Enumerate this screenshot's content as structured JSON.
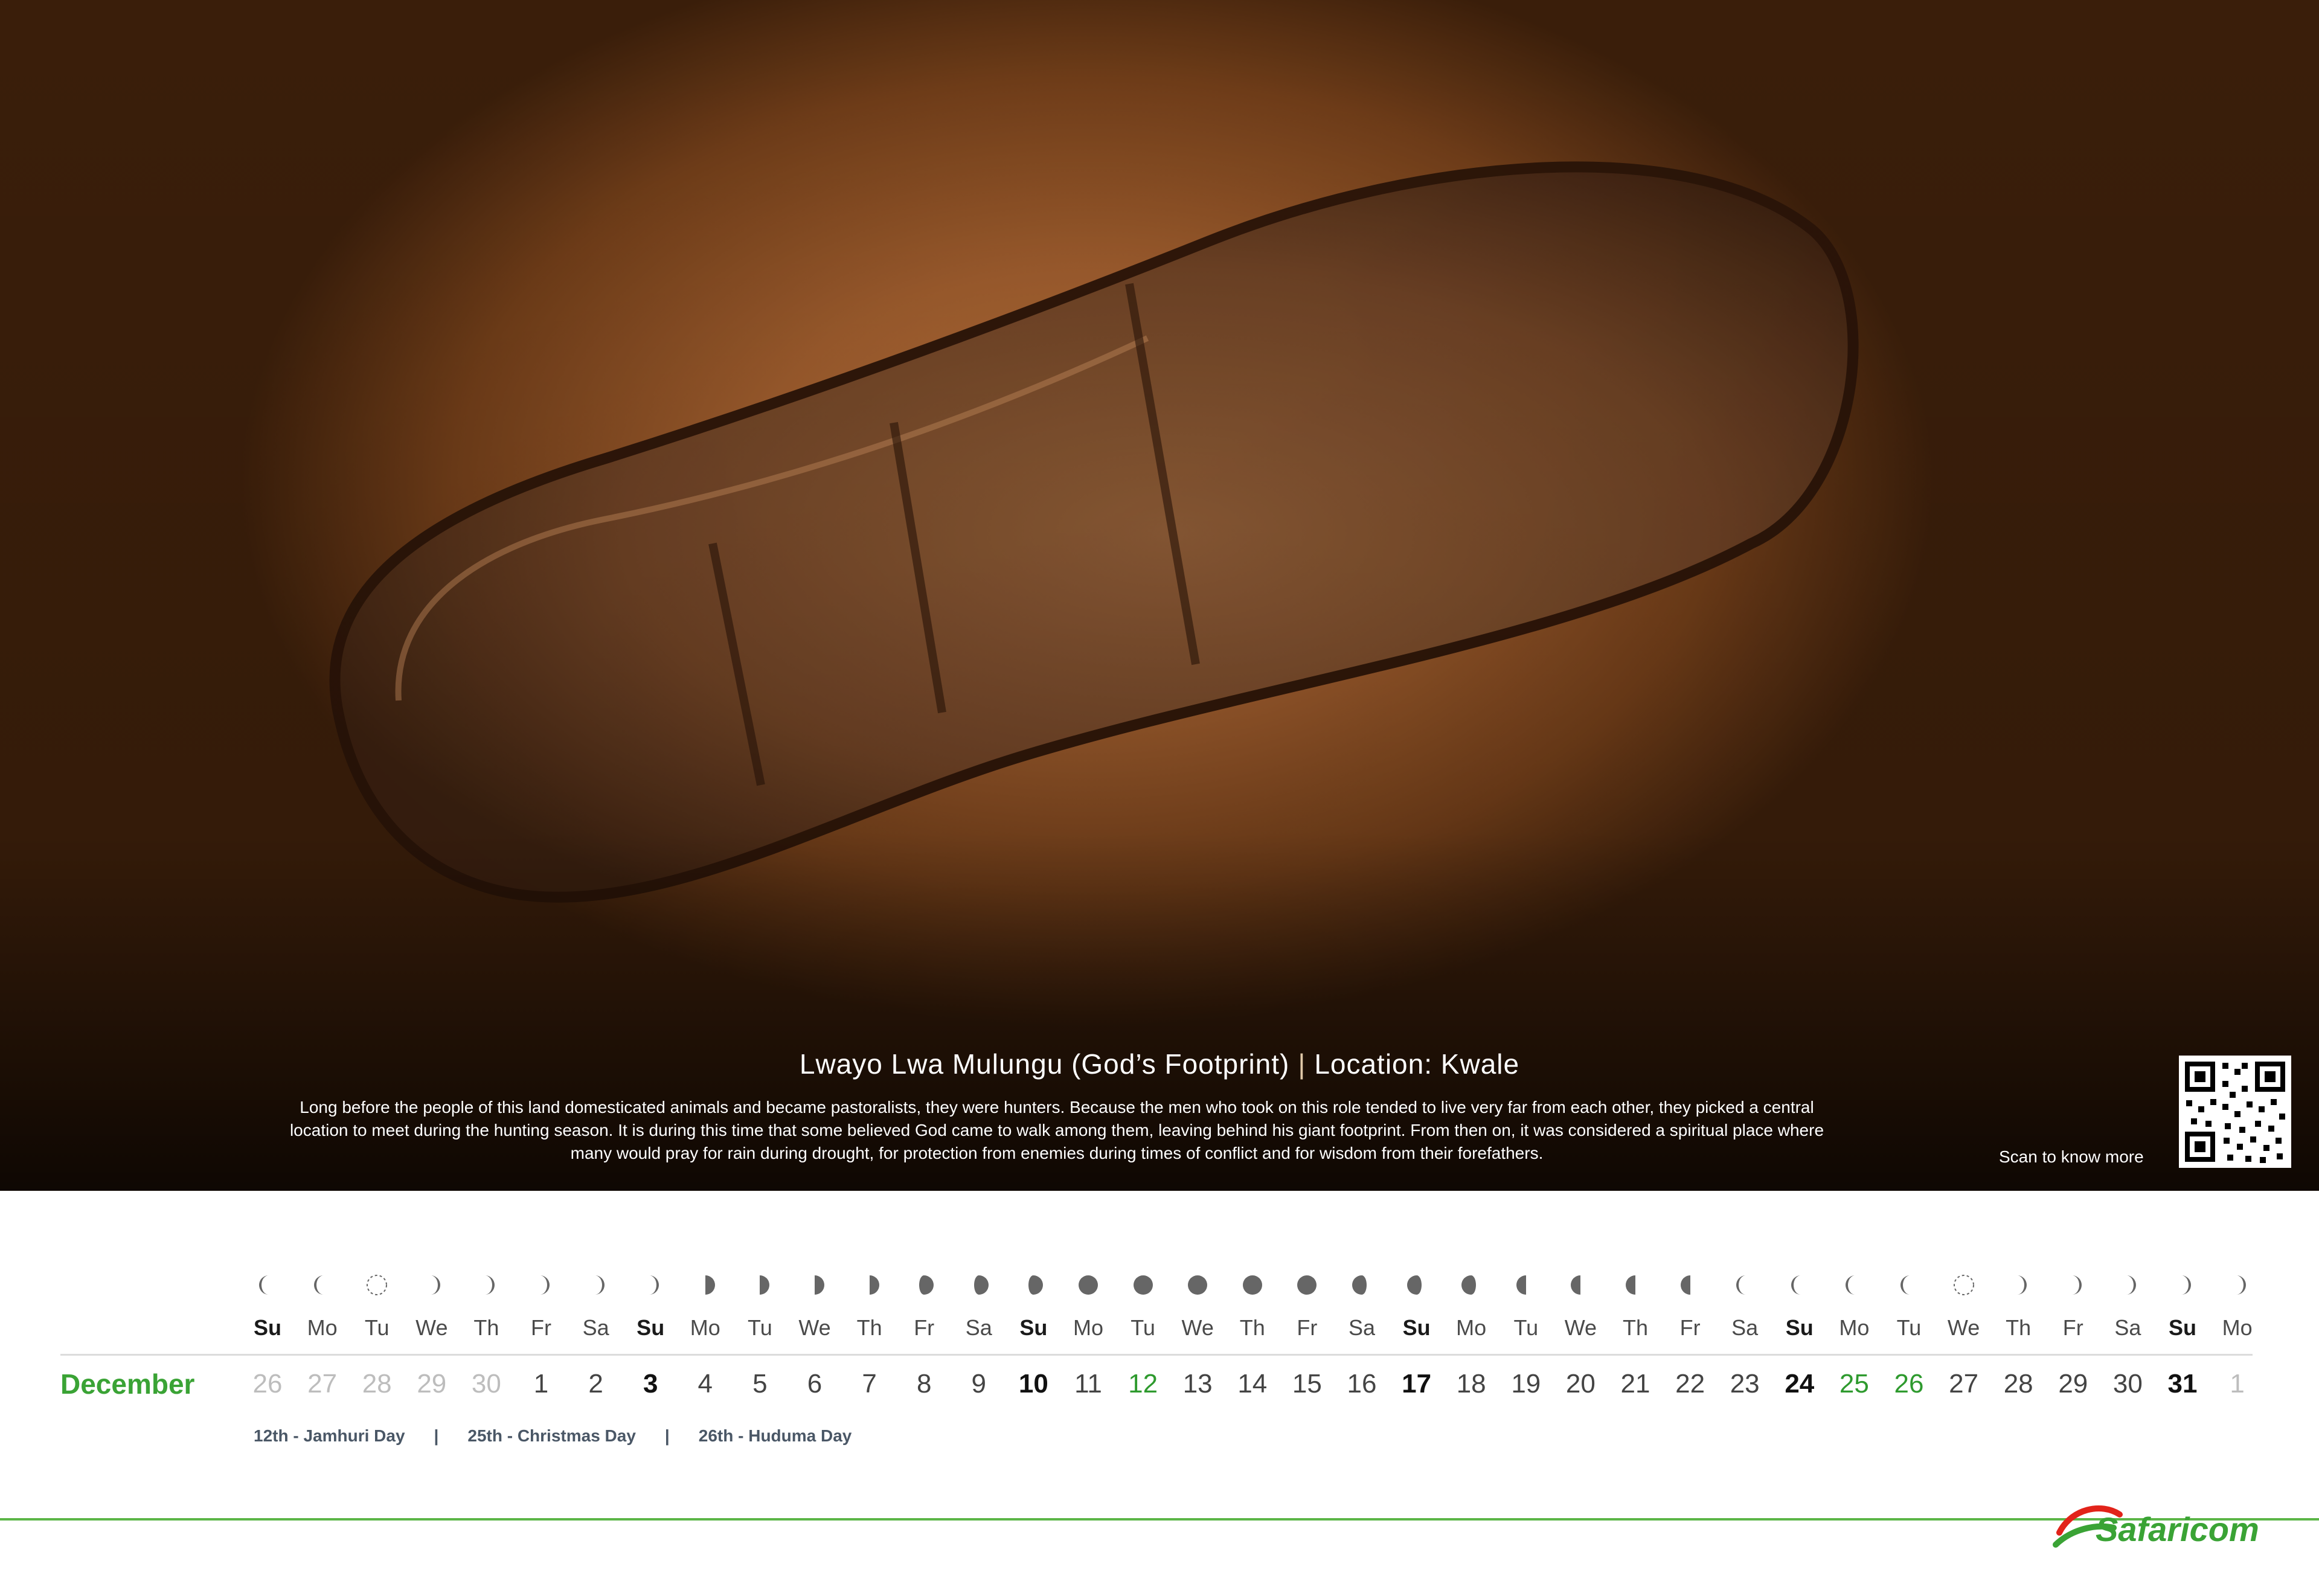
{
  "photo": {
    "title_left": "Lwayo Lwa Mulungu  (God’s Footprint)",
    "title_sep": "|",
    "title_right": "Location: Kwale",
    "body": "Long before the people of this land domesticated animals and became pastoralists, they were hunters. Because the men who took on this role tended to live very far from each other, they picked a central location to meet during the hunting season. It is during this time that some believed God came to walk among them, leaving behind his giant footprint. From then on, it was considered a spiritual place where many would pray for rain during drought, for protection from enemies during times of conflict and for wisdom from their forefathers.",
    "scan_label": "Scan to know more"
  },
  "calendar": {
    "month": "December",
    "days": [
      {
        "name": "Su",
        "num": "26",
        "type": "grey",
        "moon": "waning-crescent"
      },
      {
        "name": "Mo",
        "num": "27",
        "type": "grey",
        "moon": "waning-crescent"
      },
      {
        "name": "Tu",
        "num": "28",
        "type": "grey",
        "moon": "new"
      },
      {
        "name": "We",
        "num": "29",
        "type": "grey",
        "moon": "waxing-crescent"
      },
      {
        "name": "Th",
        "num": "30",
        "type": "grey",
        "moon": "waxing-crescent"
      },
      {
        "name": "Fr",
        "num": "1",
        "type": "normal",
        "moon": "waxing-crescent"
      },
      {
        "name": "Sa",
        "num": "2",
        "type": "normal",
        "moon": "waxing-crescent"
      },
      {
        "name": "Su",
        "num": "3",
        "type": "sun",
        "moon": "waxing-crescent"
      },
      {
        "name": "Mo",
        "num": "4",
        "type": "normal",
        "moon": "first-quarter"
      },
      {
        "name": "Tu",
        "num": "5",
        "type": "normal",
        "moon": "first-quarter"
      },
      {
        "name": "We",
        "num": "6",
        "type": "normal",
        "moon": "first-quarter"
      },
      {
        "name": "Th",
        "num": "7",
        "type": "normal",
        "moon": "first-quarter"
      },
      {
        "name": "Fr",
        "num": "8",
        "type": "normal",
        "moon": "waxing-gibbous"
      },
      {
        "name": "Sa",
        "num": "9",
        "type": "normal",
        "moon": "waxing-gibbous"
      },
      {
        "name": "Su",
        "num": "10",
        "type": "sun",
        "moon": "waxing-gibbous"
      },
      {
        "name": "Mo",
        "num": "11",
        "type": "normal",
        "moon": "full"
      },
      {
        "name": "Tu",
        "num": "12",
        "type": "hol",
        "moon": "full"
      },
      {
        "name": "We",
        "num": "13",
        "type": "normal",
        "moon": "full"
      },
      {
        "name": "Th",
        "num": "14",
        "type": "normal",
        "moon": "full"
      },
      {
        "name": "Fr",
        "num": "15",
        "type": "normal",
        "moon": "full"
      },
      {
        "name": "Sa",
        "num": "16",
        "type": "normal",
        "moon": "waning-gibbous"
      },
      {
        "name": "Su",
        "num": "17",
        "type": "sun",
        "moon": "waning-gibbous"
      },
      {
        "name": "Mo",
        "num": "18",
        "type": "normal",
        "moon": "waning-gibbous"
      },
      {
        "name": "Tu",
        "num": "19",
        "type": "normal",
        "moon": "last-quarter"
      },
      {
        "name": "We",
        "num": "20",
        "type": "normal",
        "moon": "last-quarter"
      },
      {
        "name": "Th",
        "num": "21",
        "type": "normal",
        "moon": "last-quarter"
      },
      {
        "name": "Fr",
        "num": "22",
        "type": "normal",
        "moon": "last-quarter"
      },
      {
        "name": "Sa",
        "num": "23",
        "type": "normal",
        "moon": "waning-crescent"
      },
      {
        "name": "Su",
        "num": "24",
        "type": "sun",
        "moon": "waning-crescent"
      },
      {
        "name": "Mo",
        "num": "25",
        "type": "hol",
        "moon": "waning-crescent"
      },
      {
        "name": "Tu",
        "num": "26",
        "type": "hol",
        "moon": "waning-crescent"
      },
      {
        "name": "We",
        "num": "27",
        "type": "normal",
        "moon": "new"
      },
      {
        "name": "Th",
        "num": "28",
        "type": "normal",
        "moon": "waxing-crescent"
      },
      {
        "name": "Fr",
        "num": "29",
        "type": "normal",
        "moon": "waxing-crescent"
      },
      {
        "name": "Sa",
        "num": "30",
        "type": "normal",
        "moon": "waxing-crescent"
      },
      {
        "name": "Su",
        "num": "31",
        "type": "sun",
        "moon": "waxing-crescent"
      },
      {
        "name": "Mo",
        "num": "1",
        "type": "grey",
        "moon": "waxing-crescent"
      }
    ],
    "holidays": [
      "12th - Jamhuri Day",
      "25th - Christmas Day",
      "26th - Huduma Day"
    ],
    "holiday_sep": "|"
  },
  "brand": {
    "name": "Safaricom",
    "color": "#3aa335",
    "accent": "#e2231a"
  }
}
